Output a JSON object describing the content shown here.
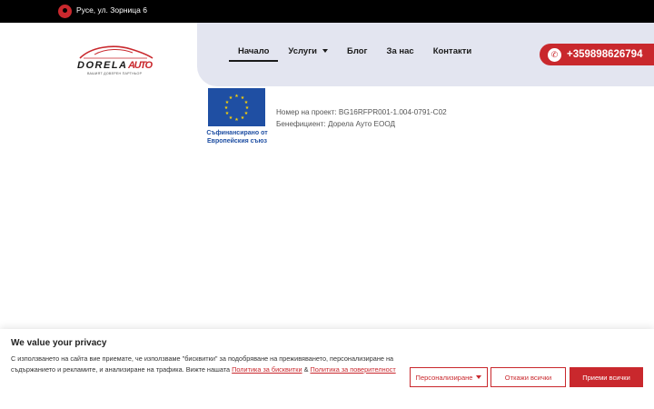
{
  "topbar": {
    "address": "Русе, ул. Зорница 6",
    "icon": "map-pin-icon"
  },
  "logo": {
    "text": "DORELA AUTO",
    "tagline": "ВАШИЯТ ДОВЕРЕН ПАРТНЬОР",
    "accent": "#c9282d"
  },
  "nav": {
    "items": [
      {
        "label": "Начало",
        "active": true
      },
      {
        "label": "Услуги",
        "has_dropdown": true
      },
      {
        "label": "Блог"
      },
      {
        "label": "За нас"
      },
      {
        "label": "Контакти"
      }
    ]
  },
  "phone": {
    "number": "+359898626794",
    "icon": "phone-icon"
  },
  "eu": {
    "caption_line1": "Съфинансирано от",
    "caption_line2": "Европейския съюз",
    "flag_color": "#1f4fa3"
  },
  "project": {
    "number_line": "Номер на проект: BG16RFPR001-1.004-0791-C02",
    "beneficiary_line": "Бенефициент: Дорела Ауто ЕООД"
  },
  "cookie": {
    "title": "We value your privacy",
    "text_before": "С използването на сайта вие приемате, че използваме \"бисквитки\" за подобряване на преживяването, персонализиране на съдържанието и рекламите, и анализиране на трафика. Вижте нашата ",
    "link1": "Политика за бисквитки",
    "text_between": " & ",
    "link2": "Политика за поверителност",
    "customize_label": "Персонализиране",
    "reject_label": "Откажи всички",
    "accept_label": "Приеми всички"
  },
  "colors": {
    "brand_red": "#c9282d",
    "nav_bg": "#e3e5f0",
    "topbar_bg": "#000000"
  }
}
